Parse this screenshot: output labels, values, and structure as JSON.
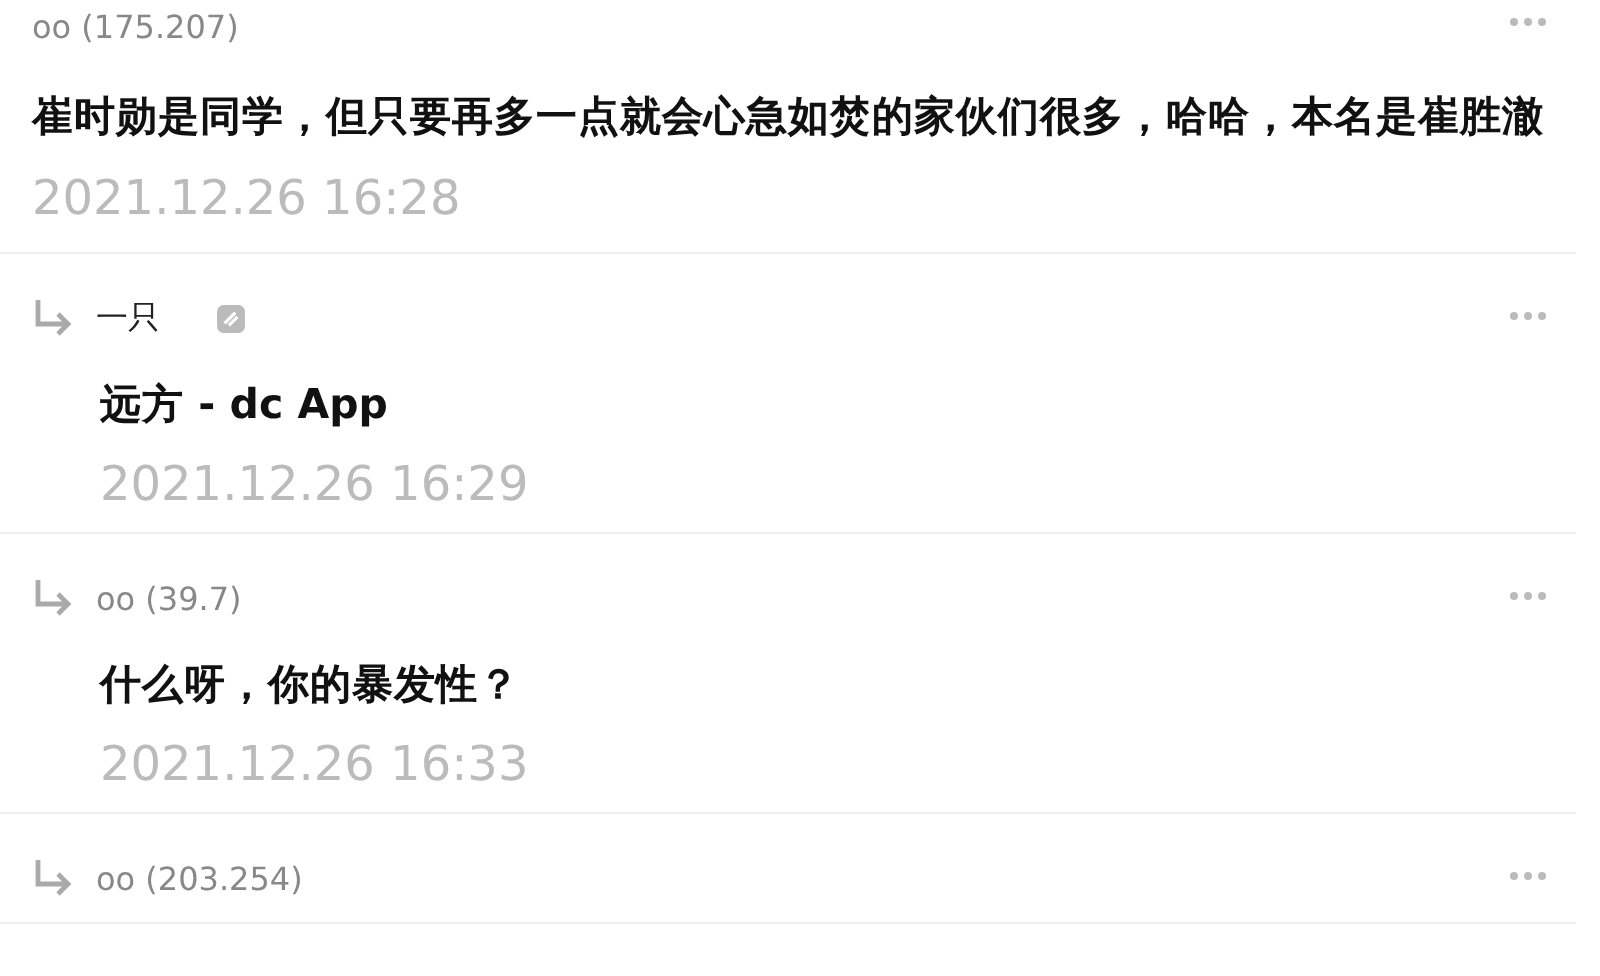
{
  "comments": [
    {
      "kind": "comment",
      "author": "oo (175.207)",
      "has_badge": false,
      "body": "崔时勋是同学，但只要再多一点就会心急如焚的家伙们很多，哈哈，本名是崔胜澈",
      "date": "2021.12.26 16:28"
    },
    {
      "kind": "reply",
      "author": "一只",
      "has_badge": true,
      "body": "远方 - dc App",
      "date": "2021.12.26 16:29"
    },
    {
      "kind": "reply",
      "author": "oo (39.7)",
      "has_badge": false,
      "body": "什么呀，你的暴发性？",
      "date": "2021.12.26 16:33"
    },
    {
      "kind": "reply",
      "author": "oo (203.254)",
      "has_badge": false
    }
  ]
}
